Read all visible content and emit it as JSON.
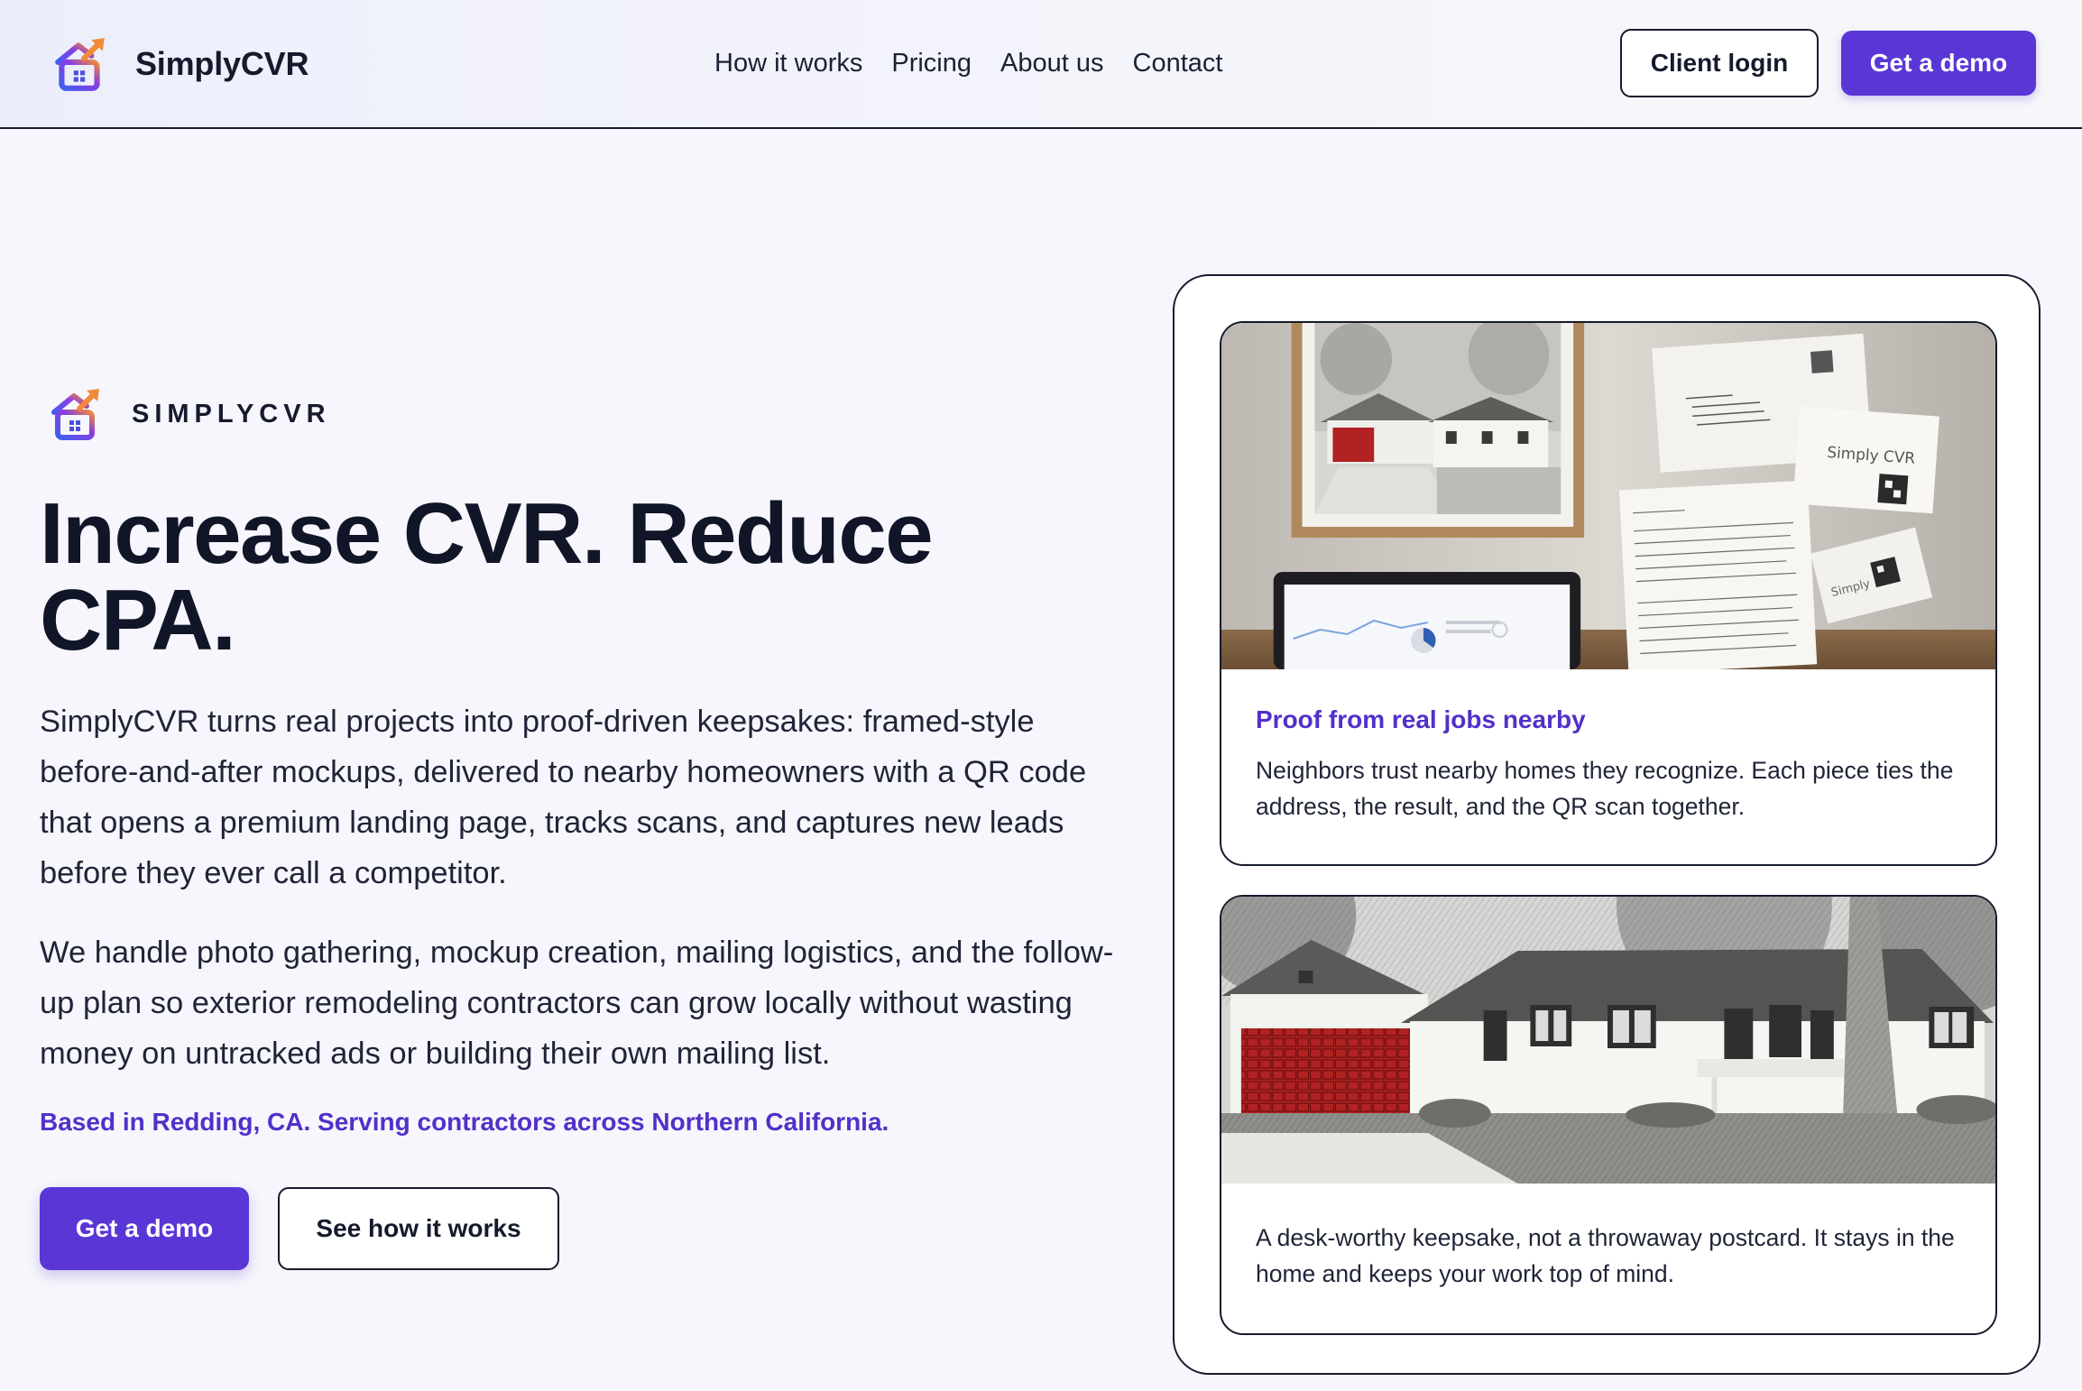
{
  "header": {
    "brand_name": "SimplyCVR",
    "nav": [
      "How it works",
      "Pricing",
      "About us",
      "Contact"
    ],
    "login_label": "Client login",
    "demo_label": "Get a demo"
  },
  "hero": {
    "eyebrow": "SIMPLYCVR",
    "title": "Increase CVR. Reduce CPA.",
    "paragraph1": "SimplyCVR turns real projects into proof-driven keepsakes: framed-style before-and-after mockups, delivered to nearby homeowners with a QR code that opens a premium landing page, tracks scans, and captures new leads before they ever call a competitor.",
    "paragraph2": "We handle photo gathering, mockup creation, mailing logistics, and the follow-up plan so exterior remodeling contractors can grow locally without wasting money on untracked ads or building their own mailing list.",
    "location": "Based in Redding, CA. Serving contractors across Northern California.",
    "cta_primary": "Get a demo",
    "cta_secondary": "See how it works"
  },
  "cards": [
    {
      "title": "Proof from real jobs nearby",
      "text": "Neighbors trust nearby homes they recognize. Each piece ties the address, the result, and the QR scan together.",
      "image_labels": [
        "Simply CVR",
        "Simply"
      ]
    },
    {
      "text": "A desk-worthy keepsake, not a throwaway postcard. It stays in the home and keeps your work top of mind."
    }
  ],
  "colors": {
    "accent": "#5a36d6",
    "accent_text": "#5230c8",
    "ink": "#151a2d",
    "background": "#f6f6fc",
    "garage_red": "#b22222"
  },
  "icons": {
    "logo": "house-with-rising-arrow-icon"
  }
}
